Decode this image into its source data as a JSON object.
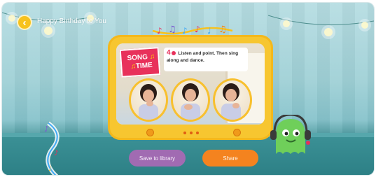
{
  "header": {
    "back_icon": "chevron-left-icon",
    "title": "Happy Birthday to You"
  },
  "lesson": {
    "badge_line1": "SONG",
    "badge_line2": "TIME",
    "badge_note": "♫",
    "number": "4",
    "instruction": "Listen and point. Then sing along and dance."
  },
  "player": {
    "pager_label": "• • •"
  },
  "actions": {
    "save_label": "Save to library",
    "share_label": "Share"
  },
  "colors": {
    "accent_yellow": "#f7c630",
    "save_purple": "#a16bb2",
    "share_orange": "#f4831f",
    "badge_red": "#e8315b",
    "mascot_green": "#6fcf5a"
  }
}
